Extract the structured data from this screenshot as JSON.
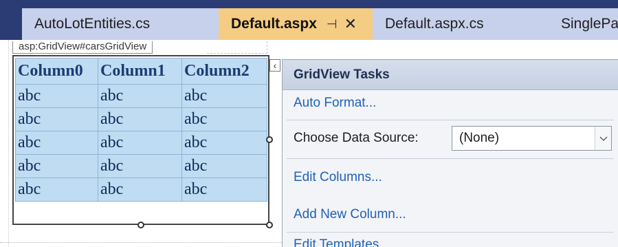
{
  "tabs": [
    {
      "label": "AutoLotEntities.cs",
      "active": false
    },
    {
      "label": "Default.aspx",
      "active": true,
      "pin": "⊣",
      "close": "✕"
    },
    {
      "label": "Default.aspx.cs",
      "active": false
    },
    {
      "label": "SinglePag",
      "active": false
    }
  ],
  "designer": {
    "control_tag": "asp:GridView#carsGridView",
    "smart_tag_glyph": "‹"
  },
  "grid": {
    "columns": [
      "Column0",
      "Column1",
      "Column2"
    ],
    "rows": [
      [
        "abc",
        "abc",
        "abc"
      ],
      [
        "abc",
        "abc",
        "abc"
      ],
      [
        "abc",
        "abc",
        "abc"
      ],
      [
        "abc",
        "abc",
        "abc"
      ],
      [
        "abc",
        "abc",
        "abc"
      ]
    ]
  },
  "tasks_panel": {
    "title": "GridView Tasks",
    "auto_format": "Auto Format...",
    "choose_data_source_label": "Choose Data Source:",
    "data_source_value": "(None)",
    "edit_columns": "Edit Columns...",
    "add_new_column": "Add New Column...",
    "edit_templates": "Edit Templates"
  },
  "colors": {
    "tabstrip_bg": "#2b3b73",
    "active_tab": "#f5cc84",
    "inactive_tab": "#c7d1ec",
    "grid_bg": "#c0dcf3",
    "link": "#2061b5"
  },
  "icons": {
    "pin": "pin-icon",
    "close": "close-icon",
    "dropdown": "chevron-down-icon",
    "smart_tag": "chevron-left-icon"
  }
}
